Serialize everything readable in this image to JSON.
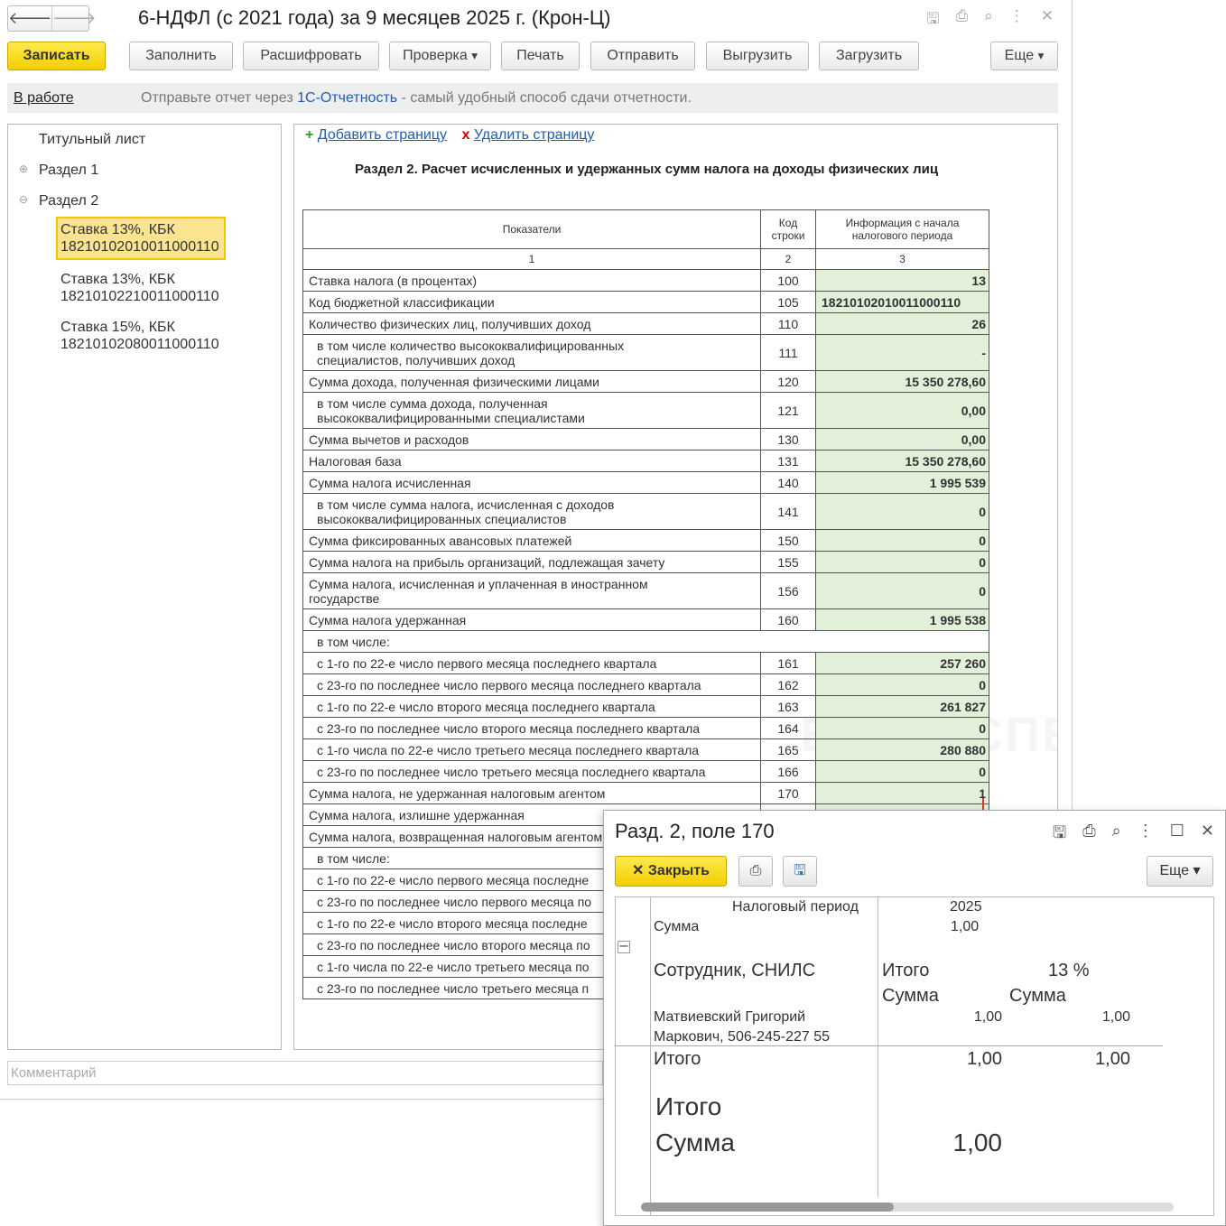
{
  "window": {
    "title": "6-НДФЛ (с 2021 года) за 9 месяцев 2025 г. (Крон-Ц)",
    "icons": [
      "save-icon",
      "print-icon",
      "preview-icon",
      "more-icon",
      "close-icon"
    ]
  },
  "toolbar": {
    "save": "Записать",
    "fill": "Заполнить",
    "decode": "Расшифровать",
    "check": "Проверка",
    "print": "Печать",
    "send": "Отправить",
    "export": "Выгрузить",
    "import": "Загрузить",
    "more": "Еще"
  },
  "info": {
    "status": "В работе",
    "msg1": "Отправьте отчет через ",
    "link": "1С-Отчетность",
    "msg2": " - самый удобный способ сдачи отчетности."
  },
  "tree": {
    "title_page": "Титульный лист",
    "sec1": "Раздел 1",
    "sec2": "Раздел 2",
    "items": [
      [
        "Ставка 13%, КБК",
        "18210102010011000110"
      ],
      [
        "Ставка 13%, КБК",
        "18210102210011000110"
      ],
      [
        "Ставка 15%, КБК",
        "18210102080011000110"
      ]
    ]
  },
  "main": {
    "add": "Добавить страницу",
    "del": "Удалить страницу",
    "heading": "Раздел 2. Расчет исчисленных и удержанных сумм налога на доходы физических лиц",
    "headers": [
      "Показатели",
      "Код строки",
      "Информация с начала налогового периода"
    ],
    "colnums": [
      "1",
      "2",
      "3"
    ],
    "rows": [
      [
        "Ставка налога (в процентах)",
        "100",
        "13",
        0
      ],
      [
        "Код бюджетной классификации",
        "105",
        "18210102010011000110",
        0
      ],
      [
        "Количество физических лиц, получивших доход",
        "110",
        "26",
        0
      ],
      [
        "в том числе количество высококвалифицированных специалистов, получивших доход",
        "111",
        "-",
        1
      ],
      [
        "Сумма дохода, полученная физическими лицами",
        "120",
        "15 350 278,60",
        0
      ],
      [
        "в том числе сумма дохода, полученная высококвалифицированными специалистами",
        "121",
        "0,00",
        1
      ],
      [
        "Сумма вычетов и расходов",
        "130",
        "0,00",
        0
      ],
      [
        "Налоговая база",
        "131",
        "15 350 278,60",
        0
      ],
      [
        "Сумма налога исчисленная",
        "140",
        "1 995 539",
        0
      ],
      [
        "в том числе сумма налога, исчисленная с доходов высококвалифицированных специалистов",
        "141",
        "0",
        1
      ],
      [
        "Сумма фиксированных авансовых платежей",
        "150",
        "0",
        0
      ],
      [
        "Сумма налога на прибыль организаций, подлежащая зачету",
        "155",
        "0",
        0
      ],
      [
        "Сумма налога, исчисленная и уплаченная в иностранном государстве",
        "156",
        "0",
        2
      ],
      [
        "Сумма налога удержанная",
        "160",
        "1 995 538",
        0
      ],
      [
        "в том числе:",
        null,
        null,
        1
      ],
      [
        "с 1-го по 22-е число первого месяца последнего квартала",
        "161",
        "257 260",
        1
      ],
      [
        "с 23-го по последнее число первого месяца последнего квартала",
        "162",
        "0",
        1
      ],
      [
        "с 1-го по 22-е число второго месяца последнего квартала",
        "163",
        "261 827",
        1
      ],
      [
        "с 23-го по последнее число второго месяца последнего квартала",
        "164",
        "0",
        1
      ],
      [
        "с 1-го числа по 22-е число третьего месяца последнего квартала",
        "165",
        "280 880",
        1
      ],
      [
        "с 23-го по последнее число третьего месяца последнего квартала",
        "166",
        "0",
        1
      ],
      [
        "Сумма налога, не удержанная налоговым агентом",
        "170",
        "1",
        0
      ],
      [
        "Сумма налога, излишне удержанная",
        "",
        "",
        0
      ],
      [
        "Сумма налога, возвращенная налоговым агентом",
        "",
        "",
        0
      ],
      [
        "в том числе:",
        null,
        null,
        1
      ],
      [
        "с 1-го по 22-е число первого месяца последне",
        "",
        "",
        1
      ],
      [
        "с 23-го по последнее число первого месяца по",
        "",
        "",
        1
      ],
      [
        "с 1-го по 22-е число второго месяца последне",
        "",
        "",
        1
      ],
      [
        "с 23-го по последнее число второго месяца по",
        "",
        "",
        1
      ],
      [
        "с 1-го числа по 22-е число третьего месяца по",
        "",
        "",
        1
      ],
      [
        "с 23-го по последнее число третьего месяца п",
        "",
        "",
        1
      ]
    ]
  },
  "comment_placeholder": "Комментарий",
  "watermark": "БУХЭКСПЕРТ",
  "popup": {
    "title": "Разд. 2, поле 170",
    "close": "Закрыть",
    "more": "Еще",
    "report": {
      "period_label": "Налоговый период",
      "period": "2025",
      "sum_label": "Сумма",
      "sum": "1,00",
      "emp_label": "Сотрудник, СНИЛС",
      "total": "Итого",
      "rate": "13 %",
      "sum_col": "Сумма",
      "employee1": "Матвиевский Григорий",
      "employee2": "Маркович, 506-245-227 55",
      "emp_total": "1,00",
      "emp_rate": "1,00",
      "tot_total": "1,00",
      "tot_rate": "1,00",
      "grand_label1": "Итого",
      "grand_label2": "Сумма",
      "grand": "1,00"
    }
  },
  "colors": {
    "accent": "#f2cf00",
    "link": "#1c5fb4",
    "cell": "#e2efd9"
  }
}
